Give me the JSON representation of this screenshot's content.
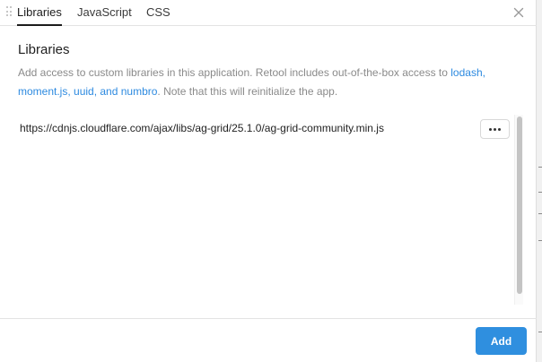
{
  "tabs": [
    {
      "label": "Libraries",
      "active": true
    },
    {
      "label": "JavaScript",
      "active": false
    },
    {
      "label": "CSS",
      "active": false
    }
  ],
  "section": {
    "title": "Libraries",
    "description_prefix": "Add access to custom libraries in this application. Retool includes out-of-the-box access to ",
    "links": [
      "lodash,",
      "moment.js, uuid, and numbro"
    ],
    "link_joiner": " ",
    "description_suffix": ". Note that this will reinitialize the app."
  },
  "libraries": [
    {
      "url": "https://cdnjs.cloudflare.com/ajax/libs/ag-grid/25.1.0/ag-grid-community.min.js",
      "menu_icon": "ellipsis-icon"
    }
  ],
  "footer": {
    "add_label": "Add"
  },
  "icons": {
    "close": "close-icon",
    "drag": "drag-handle-icon",
    "more": "ellipsis-icon"
  },
  "colors": {
    "accent": "#2f8fdf",
    "link": "#2d8ae0",
    "muted_text": "#8a8a8a"
  }
}
